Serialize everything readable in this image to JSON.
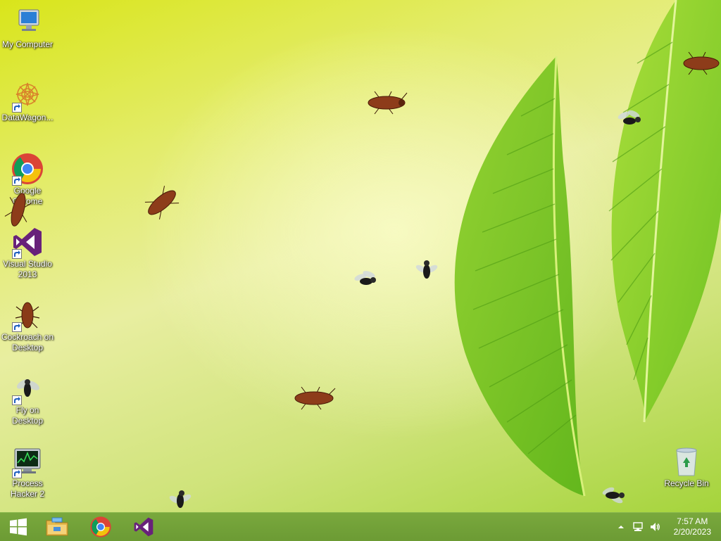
{
  "desktop_icons": [
    {
      "label": "My Computer"
    },
    {
      "label": "DataWagon..."
    },
    {
      "label": "Google Chrome"
    },
    {
      "label": "Visual Studio 2013"
    },
    {
      "label": "Cockroach on Desktop"
    },
    {
      "label": "Fly on Desktop"
    },
    {
      "label": "Process Hacker 2"
    },
    {
      "label": "Recycle Bin"
    }
  ],
  "taskbar": {
    "pinned": [
      "start-icon",
      "file-explorer-icon",
      "chrome-icon",
      "visual-studio-icon"
    ]
  },
  "tray": {
    "time": "7:57 AM",
    "date": "2/20/2023"
  },
  "colors": {
    "taskbar": "#6c9b34",
    "accent_purple": "#68217a"
  }
}
